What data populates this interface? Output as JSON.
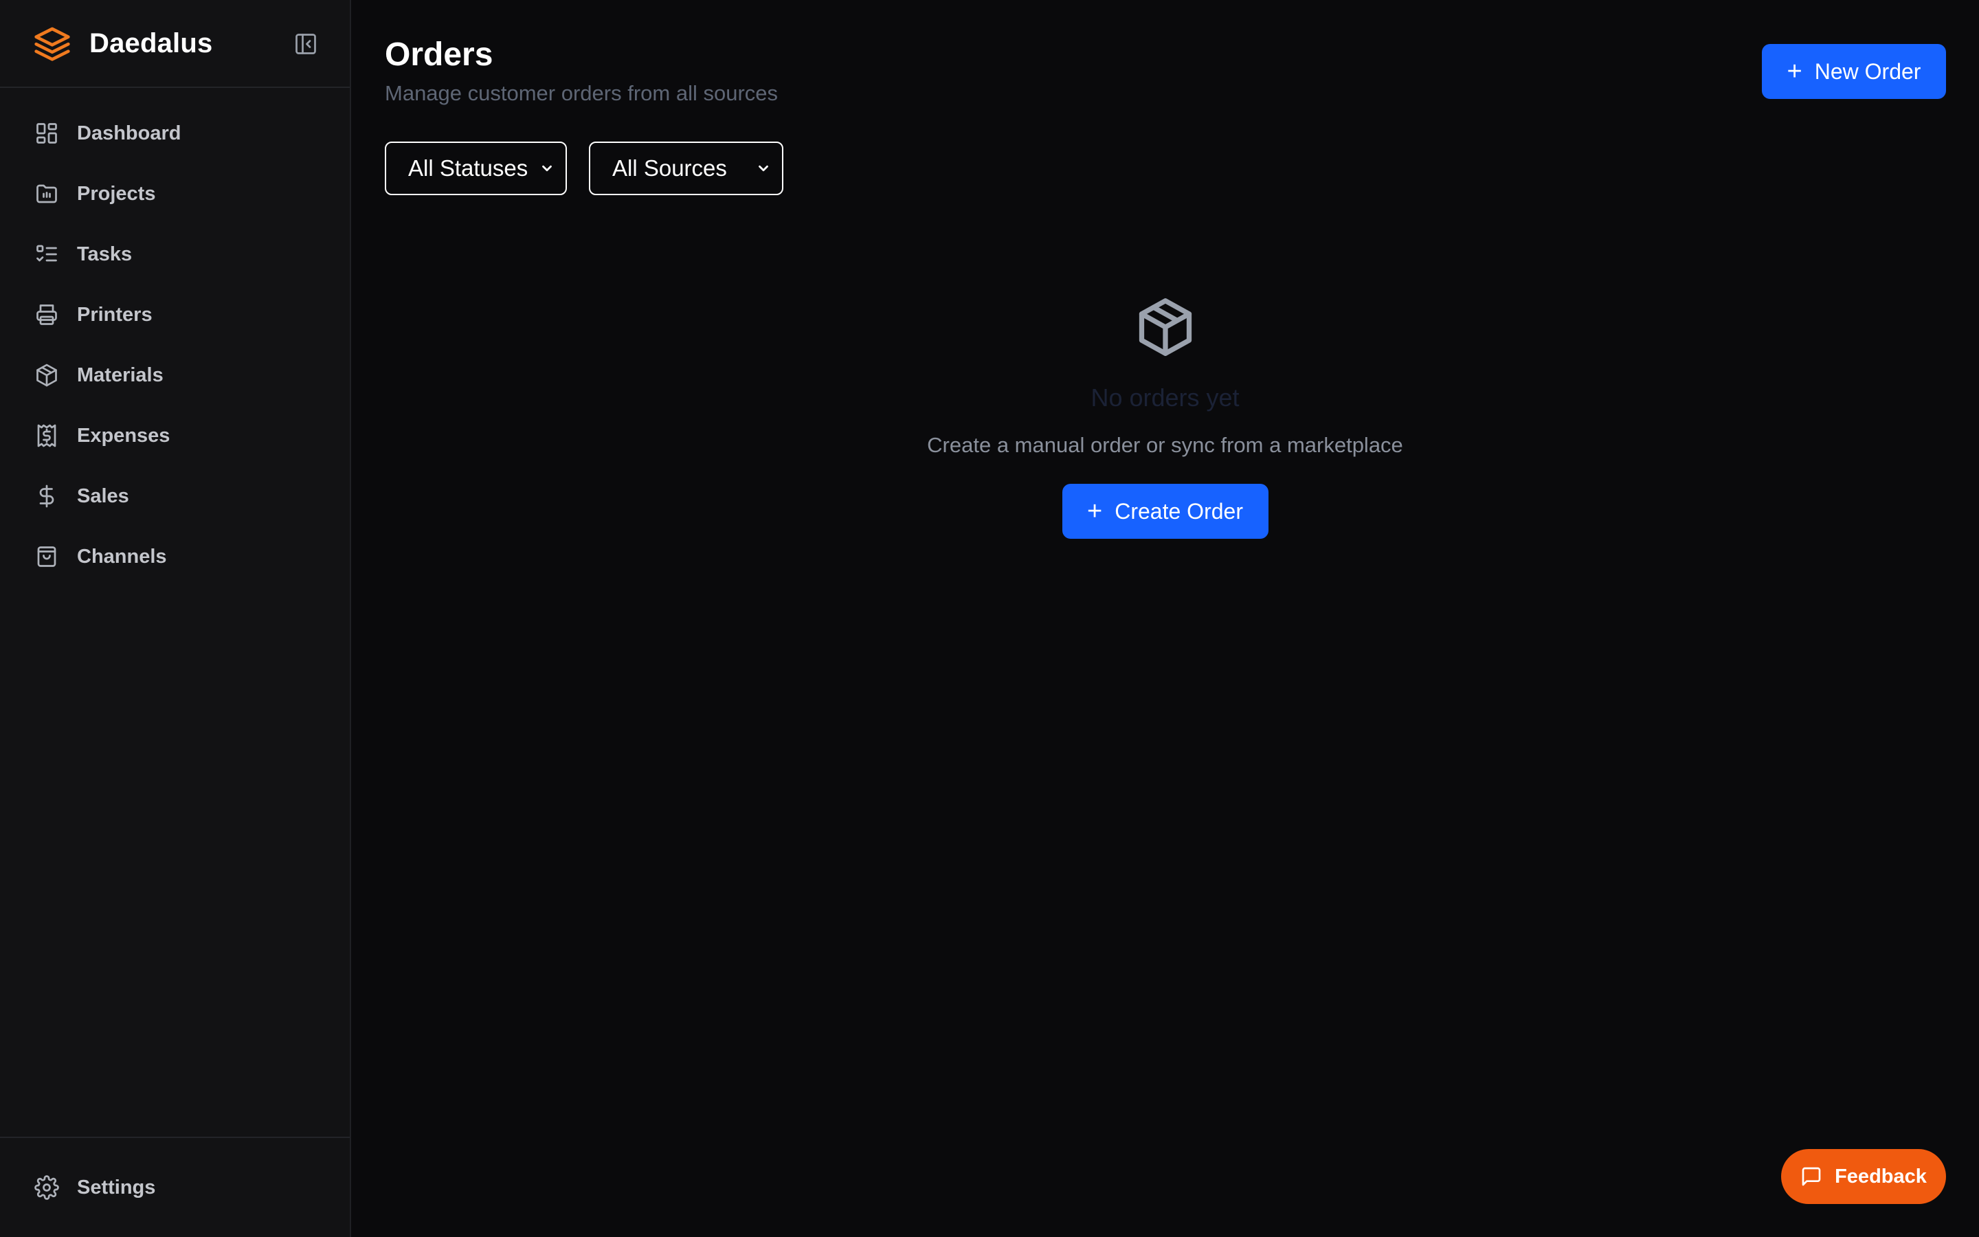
{
  "brand": {
    "name": "Daedalus"
  },
  "sidebar": {
    "items": [
      {
        "label": "Dashboard",
        "icon": "dashboard-icon"
      },
      {
        "label": "Projects",
        "icon": "folder-icon"
      },
      {
        "label": "Tasks",
        "icon": "list-check-icon"
      },
      {
        "label": "Printers",
        "icon": "printer-icon"
      },
      {
        "label": "Materials",
        "icon": "box-icon"
      },
      {
        "label": "Expenses",
        "icon": "receipt-icon"
      },
      {
        "label": "Sales",
        "icon": "dollar-icon"
      },
      {
        "label": "Channels",
        "icon": "shopping-bag-icon"
      }
    ],
    "footer": {
      "label": "Settings",
      "icon": "gear-icon"
    }
  },
  "header": {
    "title": "Orders",
    "subtitle": "Manage customer orders from all sources",
    "new_order_label": "New Order"
  },
  "filters": {
    "status": {
      "selected": "All Statuses"
    },
    "source": {
      "selected": "All Sources"
    }
  },
  "empty_state": {
    "icon": "package-icon",
    "title": "No orders yet",
    "description": "Create a manual order or sync from a marketplace",
    "button_label": "Create Order"
  },
  "feedback": {
    "label": "Feedback",
    "icon": "message-icon"
  },
  "colors": {
    "accent": "#1762ff",
    "brand": "#f07a1f",
    "feedback": "#f05a0f",
    "background": "#0a0a0c",
    "sidebar": "#121214"
  }
}
